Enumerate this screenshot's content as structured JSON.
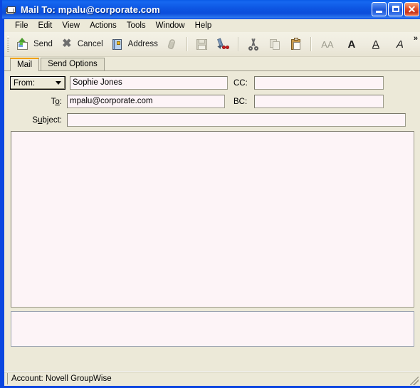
{
  "window": {
    "title": "Mail To: mpalu@corporate.com",
    "title_icon": "mail-envelope-icon",
    "buttons": {
      "minimize": "minimize-button",
      "maximize": "maximize-button",
      "close": "✕"
    },
    "colors": {
      "titlebar": "#0d55e2",
      "client": "#ece9d8",
      "field": "#fdf4f7",
      "active_tab_accent": "#f0a000",
      "close_button": "#e2502a"
    }
  },
  "menu": {
    "items": [
      {
        "label": "File"
      },
      {
        "label": "Edit"
      },
      {
        "label": "View"
      },
      {
        "label": "Actions"
      },
      {
        "label": "Tools"
      },
      {
        "label": "Window"
      },
      {
        "label": "Help"
      }
    ]
  },
  "toolbar": {
    "send_label": "Send",
    "cancel_label": "Cancel",
    "address_label": "Address",
    "overflow_label": "»",
    "font_size_label": "AA",
    "bold_label": "A",
    "underline_label": "A",
    "italic_label": "A",
    "icons": [
      "send-icon",
      "cancel-icon",
      "address-book-icon",
      "attach-paperclip-icon",
      "save-icon",
      "spell-check-icon",
      "cut-icon",
      "copy-icon",
      "paste-icon",
      "font-size-icon",
      "bold-icon",
      "underline-icon",
      "italic-icon",
      "overflow-chevron-icon"
    ]
  },
  "tabs": [
    {
      "label": "Mail",
      "active": true
    },
    {
      "label": "Send Options",
      "active": false
    }
  ],
  "form": {
    "from": {
      "select_label": "From:",
      "value": "Sophie Jones",
      "placeholder": ""
    },
    "to": {
      "label_pre": "T",
      "label_mnemonic": "o",
      "label_post": ":",
      "value": "mpalu@corporate.com",
      "placeholder": ""
    },
    "subject": {
      "label_pre": "S",
      "label_mnemonic": "u",
      "label_post": "bject:",
      "value": "",
      "placeholder": ""
    },
    "cc": {
      "label": "CC:",
      "value": "",
      "placeholder": ""
    },
    "bc": {
      "label": "BC:",
      "value": "",
      "placeholder": ""
    },
    "body": {
      "value": "",
      "placeholder": ""
    },
    "attachments": {
      "value": "",
      "placeholder": ""
    }
  },
  "statusbar": {
    "account_text": "Account: Novell GroupWise"
  }
}
